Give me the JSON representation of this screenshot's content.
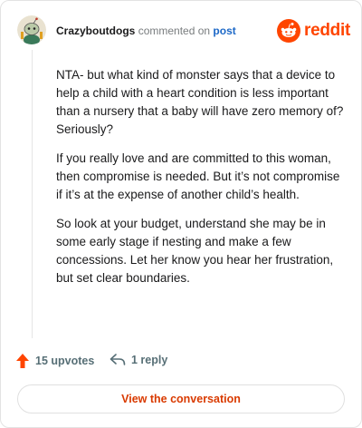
{
  "comment": {
    "author": "Crazyboutdogs",
    "action_text": "commented on",
    "post_link": "post",
    "paragraphs": [
      "NTA- but what kind of monster says that a device to help a child with a heart condition is less important than a nursery that a baby will have zero memory of? Seriously?",
      "If you really love and are committed to this woman, then compromise is needed. But it’s not compromise if it’s at the expense of another child’s health.",
      "So look at your budget, understand she may be in some early stage if nesting and make a few concessions. Let her know you hear her frustration, but set clear boundaries."
    ]
  },
  "brand": {
    "name": "reddit",
    "color": "#ff4500"
  },
  "actions": {
    "upvotes_label": "15 upvotes",
    "replies_label": "1 reply"
  },
  "cta": {
    "label": "View the conversation"
  },
  "colors": {
    "link": "#1c68c7",
    "upvote_arrow": "#ff4500",
    "cta_text": "#d93a00",
    "meta_text": "#787c7e"
  },
  "icons": {
    "avatar": "snoo-avatar-icon",
    "upvote": "upvote-arrow-icon",
    "reply": "reply-arrow-icon",
    "logo": "reddit-snoo-icon"
  }
}
